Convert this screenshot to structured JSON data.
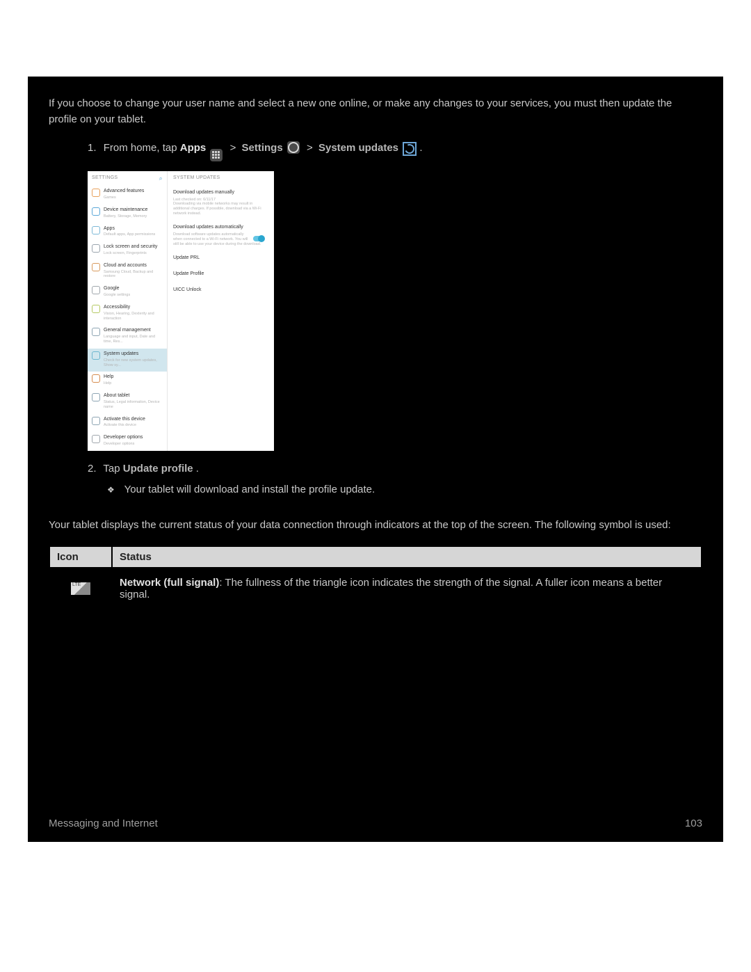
{
  "intro_paragraph": "If you choose to change your user name and select a new one online, or make any changes to your services, you must then update the profile on your tablet.",
  "step1": {
    "number": "1.",
    "prefix": "From home, tap ",
    "apps_label": "Apps",
    "settings_label": "Settings",
    "system_updates_label": "System updates",
    "period": ".",
    "separator": " > "
  },
  "step2": {
    "number": "2.",
    "prefix": "Tap ",
    "bold": "Update profile",
    "suffix": ".",
    "sub_bullet": "Your tablet will download and install the profile update."
  },
  "status_intro": "Your tablet displays the current status of your data connection through indicators at the top of the screen. The following symbol is used:",
  "status_table": {
    "headers": {
      "icon": "Icon",
      "status": "Status"
    },
    "row": {
      "badge": "LTE",
      "bold": "Network (full signal)",
      "rest": ": The fullness of the triangle icon indicates the strength of the signal. A fuller icon means a better signal."
    }
  },
  "footer": {
    "left": "Messaging and Internet",
    "right": "103"
  },
  "shot": {
    "left_header": "SETTINGS",
    "right_header": "SYSTEM UPDATES",
    "left_items": [
      {
        "title": "Advanced features",
        "sub": "Games"
      },
      {
        "title": "Device maintenance",
        "sub": "Battery, Storage, Memory"
      },
      {
        "title": "Apps",
        "sub": "Default apps, App permissions"
      },
      {
        "title": "Lock screen and security",
        "sub": "Lock screen, Fingerprints"
      },
      {
        "title": "Cloud and accounts",
        "sub": "Samsung Cloud, Backup and restore"
      },
      {
        "title": "Google",
        "sub": "Google settings"
      },
      {
        "title": "Accessibility",
        "sub": "Vision, Hearing, Dexterity and interaction"
      },
      {
        "title": "General management",
        "sub": "Language and input, Date and time, Res..."
      },
      {
        "title": "System updates",
        "sub": "Check for new system updates, Show sy..."
      },
      {
        "title": "Help",
        "sub": "Help"
      },
      {
        "title": "About tablet",
        "sub": "Status, Legal information, Device name"
      },
      {
        "title": "Activate this device",
        "sub": "Activate this device"
      },
      {
        "title": "Developer options",
        "sub": "Developer options"
      }
    ],
    "left_icon_colors": [
      "#e8a05a",
      "#5aa7d8",
      "#7db8d7",
      "#9aa4ad",
      "#d89a5d",
      "#a0a7ad",
      "#b5c963",
      "#8ea5b3",
      "#6cb6cf",
      "#d68b4d",
      "#8ea5b3",
      "#8ea5b3",
      "#a0a7ad"
    ],
    "right_items": {
      "download_manual": {
        "title": "Download updates manually",
        "sub": "Last checked on: 6/11/17\nDownloading via mobile networks may result in additional charges. If possible, download via a Wi-Fi network instead."
      },
      "download_auto": {
        "title": "Download updates automatically",
        "sub": "Download software updates automatically when connected to a Wi-Fi network. You will still be able to use your device during the download."
      },
      "line1": "Update PRL",
      "line2": "Update Profile",
      "line3": "UICC Unlock"
    }
  }
}
